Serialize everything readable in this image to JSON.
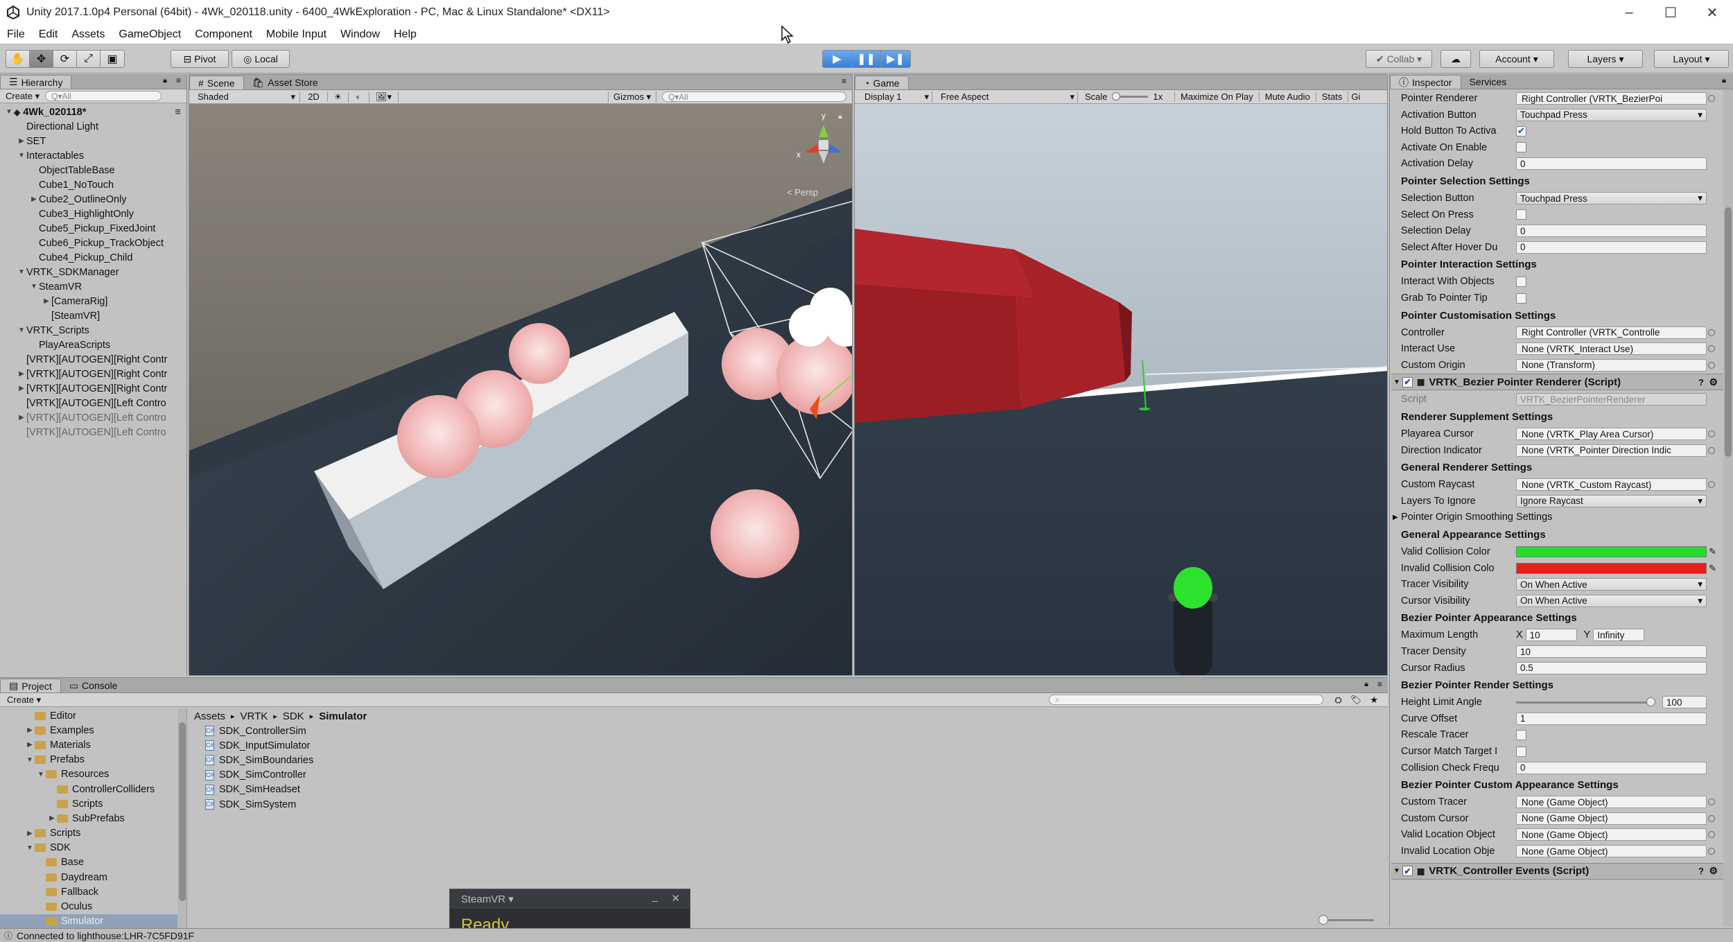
{
  "window": {
    "title": "Unity 2017.1.0p4 Personal (64bit) - 4Wk_020118.unity - 6400_4WkExploration - PC, Mac & Linux Standalone* <DX11>",
    "minimize": "–",
    "maximize": "☐",
    "close": "✕"
  },
  "menu": [
    "File",
    "Edit",
    "Assets",
    "GameObject",
    "Component",
    "Mobile Input",
    "Window",
    "Help"
  ],
  "toolbar": {
    "pivot": "Pivot",
    "local": "Local",
    "collab": "Collab ▾",
    "account": "Account ▾",
    "layers": "Layers ▾",
    "layout": "Layout ▾"
  },
  "hierarchy": {
    "tab": "Hierarchy",
    "create": "Create ▾",
    "search": "Q▾All",
    "items": [
      {
        "label": "4Wk_020118*",
        "indent": 0,
        "arrow": "▼",
        "style": "bold"
      },
      {
        "label": "Directional Light",
        "indent": 1,
        "arrow": "",
        "style": ""
      },
      {
        "label": "SET",
        "indent": 1,
        "arrow": "▶",
        "style": ""
      },
      {
        "label": "Interactables",
        "indent": 1,
        "arrow": "▼",
        "style": ""
      },
      {
        "label": "ObjectTableBase",
        "indent": 2,
        "arrow": "",
        "style": ""
      },
      {
        "label": "Cube1_NoTouch",
        "indent": 2,
        "arrow": "",
        "style": ""
      },
      {
        "label": "Cube2_OutlineOnly",
        "indent": 2,
        "arrow": "▶",
        "style": ""
      },
      {
        "label": "Cube3_HighlightOnly",
        "indent": 2,
        "arrow": "",
        "style": ""
      },
      {
        "label": "Cube5_Pickup_FixedJoint",
        "indent": 2,
        "arrow": "",
        "style": ""
      },
      {
        "label": "Cube6_Pickup_TrackObject",
        "indent": 2,
        "arrow": "",
        "style": ""
      },
      {
        "label": "Cube4_Pickup_Child",
        "indent": 2,
        "arrow": "",
        "style": ""
      },
      {
        "label": "VRTK_SDKManager",
        "indent": 1,
        "arrow": "▼",
        "style": ""
      },
      {
        "label": "SteamVR",
        "indent": 2,
        "arrow": "▼",
        "style": ""
      },
      {
        "label": "[CameraRig]",
        "indent": 3,
        "arrow": "▶",
        "style": ""
      },
      {
        "label": "[SteamVR]",
        "indent": 3,
        "arrow": "",
        "style": ""
      },
      {
        "label": "VRTK_Scripts",
        "indent": 1,
        "arrow": "▼",
        "style": ""
      },
      {
        "label": "PlayAreaScripts",
        "indent": 2,
        "arrow": "",
        "style": ""
      },
      {
        "label": "[VRTK][AUTOGEN][Right Contr",
        "indent": 1,
        "arrow": "",
        "style": ""
      },
      {
        "label": "[VRTK][AUTOGEN][Right Contr",
        "indent": 1,
        "arrow": "▶",
        "style": ""
      },
      {
        "label": "[VRTK][AUTOGEN][Right Contr",
        "indent": 1,
        "arrow": "▶",
        "style": ""
      },
      {
        "label": "[VRTK][AUTOGEN][Left Contro",
        "indent": 1,
        "arrow": "",
        "style": ""
      },
      {
        "label": "[VRTK][AUTOGEN][Left Contro",
        "indent": 1,
        "arrow": "▶",
        "style": "grey"
      },
      {
        "label": "[VRTK][AUTOGEN][Left Contro",
        "indent": 1,
        "arrow": "",
        "style": "grey"
      }
    ]
  },
  "scene": {
    "tab_scene": "Scene",
    "tab_asset_store": "Asset Store",
    "shading": "Shaded",
    "mode2d": "2D",
    "gizmos": "Gizmos ▾",
    "search": "Q▾All",
    "persp": "< Persp",
    "axis_y": "y",
    "axis_x": "x"
  },
  "game": {
    "tab": "Game",
    "display": "Display 1",
    "aspect": "Free Aspect",
    "scale_label": "Scale",
    "scale_value": "1x",
    "maximize": "Maximize On Play",
    "mute": "Mute Audio",
    "stats": "Stats",
    "gizmos": "Gi"
  },
  "inspector": {
    "tab": "Inspector",
    "services": "Services",
    "colors": {
      "valid": "#22e02a",
      "invalid": "#e8201a"
    },
    "rows1": [
      {
        "label": "Pointer Renderer",
        "value": "Right Controller (VRTK_BezierPoi",
        "kind": "obj"
      },
      {
        "label": "Activation Button",
        "value": "Touchpad Press",
        "kind": "drop"
      },
      {
        "label": "Hold Button To Activa",
        "value": "✔",
        "kind": "chk"
      },
      {
        "label": "Activate On Enable",
        "value": "",
        "kind": "chk"
      },
      {
        "label": "Activation Delay",
        "value": "0",
        "kind": "text"
      }
    ],
    "h_selection": "Pointer Selection Settings",
    "rows2": [
      {
        "label": "Selection Button",
        "value": "Touchpad Press",
        "kind": "drop"
      },
      {
        "label": "Select On Press",
        "value": "",
        "kind": "chk"
      },
      {
        "label": "Selection Delay",
        "value": "0",
        "kind": "text"
      },
      {
        "label": "Select After Hover Du",
        "value": "0",
        "kind": "text"
      }
    ],
    "h_interaction": "Pointer Interaction Settings",
    "rows3": [
      {
        "label": "Interact With Objects",
        "value": "",
        "kind": "chk"
      },
      {
        "label": "Grab To Pointer Tip",
        "value": "",
        "kind": "chk"
      }
    ],
    "h_custom": "Pointer Customisation Settings",
    "rows4": [
      {
        "label": "Controller",
        "value": "Right Controller (VRTK_Controlle",
        "kind": "obj"
      },
      {
        "label": "Interact Use",
        "value": "None (VRTK_Interact Use)",
        "kind": "obj"
      },
      {
        "label": "Custom Origin",
        "value": "None (Transform)",
        "kind": "obj"
      }
    ],
    "comp_bezier": "VRTK_Bezier Pointer Renderer (Script)",
    "script_label": "Script",
    "script_value": "VRTK_BezierPointerRenderer",
    "h_supplement": "Renderer Supplement Settings",
    "rows5": [
      {
        "label": "Playarea Cursor",
        "value": "None (VRTK_Play Area Cursor)",
        "kind": "obj"
      },
      {
        "label": "Direction Indicator",
        "value": "None (VRTK_Pointer Direction Indic",
        "kind": "obj"
      }
    ],
    "h_general_renderer": "General Renderer Settings",
    "rows6": [
      {
        "label": "Custom Raycast",
        "value": "None (VRTK_Custom Raycast)",
        "kind": "obj"
      },
      {
        "label": "Layers To Ignore",
        "value": "Ignore Raycast",
        "kind": "drop"
      }
    ],
    "foldout_smoothing": "Pointer Origin Smoothing Settings",
    "h_appearance": "General Appearance Settings",
    "valid_color_label": "Valid Collision Color",
    "invalid_color_label": "Invalid Collision Colo",
    "rows7": [
      {
        "label": "Tracer Visibility",
        "value": "On When Active",
        "kind": "drop"
      },
      {
        "label": "Cursor Visibility",
        "value": "On When Active",
        "kind": "drop"
      }
    ],
    "h_bezier_appearance": "Bezier Pointer Appearance Settings",
    "max_length_label": "Maximum Length",
    "max_length_x_label": "X",
    "max_length_x": "10",
    "max_length_y_label": "Y",
    "max_length_y": "Infinity",
    "rows8": [
      {
        "label": "Tracer Density",
        "value": "10",
        "kind": "text"
      },
      {
        "label": "Cursor Radius",
        "value": "0.5",
        "kind": "text"
      }
    ],
    "h_bezier_render": "Bezier Pointer Render Settings",
    "height_limit_label": "Height Limit Angle",
    "height_limit_value": "100",
    "height_limit_fraction": 0.98,
    "rows9": [
      {
        "label": "Curve Offset",
        "value": "1",
        "kind": "text"
      },
      {
        "label": "Rescale Tracer",
        "value": "",
        "kind": "chk"
      },
      {
        "label": "Cursor Match Target I",
        "value": "",
        "kind": "chk"
      },
      {
        "label": "Collision Check Frequ",
        "value": "0",
        "kind": "text"
      }
    ],
    "h_bezier_custom": "Bezier Pointer Custom Appearance Settings",
    "rows10": [
      {
        "label": "Custom Tracer",
        "value": "None (Game Object)",
        "kind": "obj"
      },
      {
        "label": "Custom Cursor",
        "value": "None (Game Object)",
        "kind": "obj"
      },
      {
        "label": "Valid Location Object",
        "value": "None (Game Object)",
        "kind": "obj"
      },
      {
        "label": "Invalid Location Obje",
        "value": "None (Game Object)",
        "kind": "obj"
      }
    ],
    "comp_events": "VRTK_Controller Events (Script)"
  },
  "project": {
    "tab_project": "Project",
    "tab_console": "Console",
    "create": "Create ▾",
    "folders": [
      {
        "label": "Editor",
        "indent": 2,
        "arrow": ""
      },
      {
        "label": "Examples",
        "indent": 2,
        "arrow": "▶"
      },
      {
        "label": "Materials",
        "indent": 2,
        "arrow": "▶"
      },
      {
        "label": "Prefabs",
        "indent": 2,
        "arrow": "▼"
      },
      {
        "label": "Resources",
        "indent": 3,
        "arrow": "▼"
      },
      {
        "label": "ControllerColliders",
        "indent": 4,
        "arrow": ""
      },
      {
        "label": "Scripts",
        "indent": 4,
        "arrow": ""
      },
      {
        "label": "SubPrefabs",
        "indent": 4,
        "arrow": "▶"
      },
      {
        "label": "Scripts",
        "indent": 2,
        "arrow": "▶"
      },
      {
        "label": "SDK",
        "indent": 2,
        "arrow": "▼"
      },
      {
        "label": "Base",
        "indent": 3,
        "arrow": ""
      },
      {
        "label": "Daydream",
        "indent": 3,
        "arrow": ""
      },
      {
        "label": "Fallback",
        "indent": 3,
        "arrow": ""
      },
      {
        "label": "Oculus",
        "indent": 3,
        "arrow": ""
      },
      {
        "label": "Simulator",
        "indent": 3,
        "arrow": ""
      }
    ],
    "breadcrumb": [
      "Assets",
      "VRTK",
      "SDK",
      "Simulator"
    ],
    "files": [
      "SDK_ControllerSim",
      "SDK_InputSimulator",
      "SDK_SimBoundaries",
      "SDK_SimController",
      "SDK_SimHeadset",
      "SDK_SimSystem"
    ]
  },
  "steamvr": {
    "title": "SteamVR ▾",
    "status": "Ready"
  },
  "status": "Connected to lighthouse:LHR-7C5FD91F"
}
